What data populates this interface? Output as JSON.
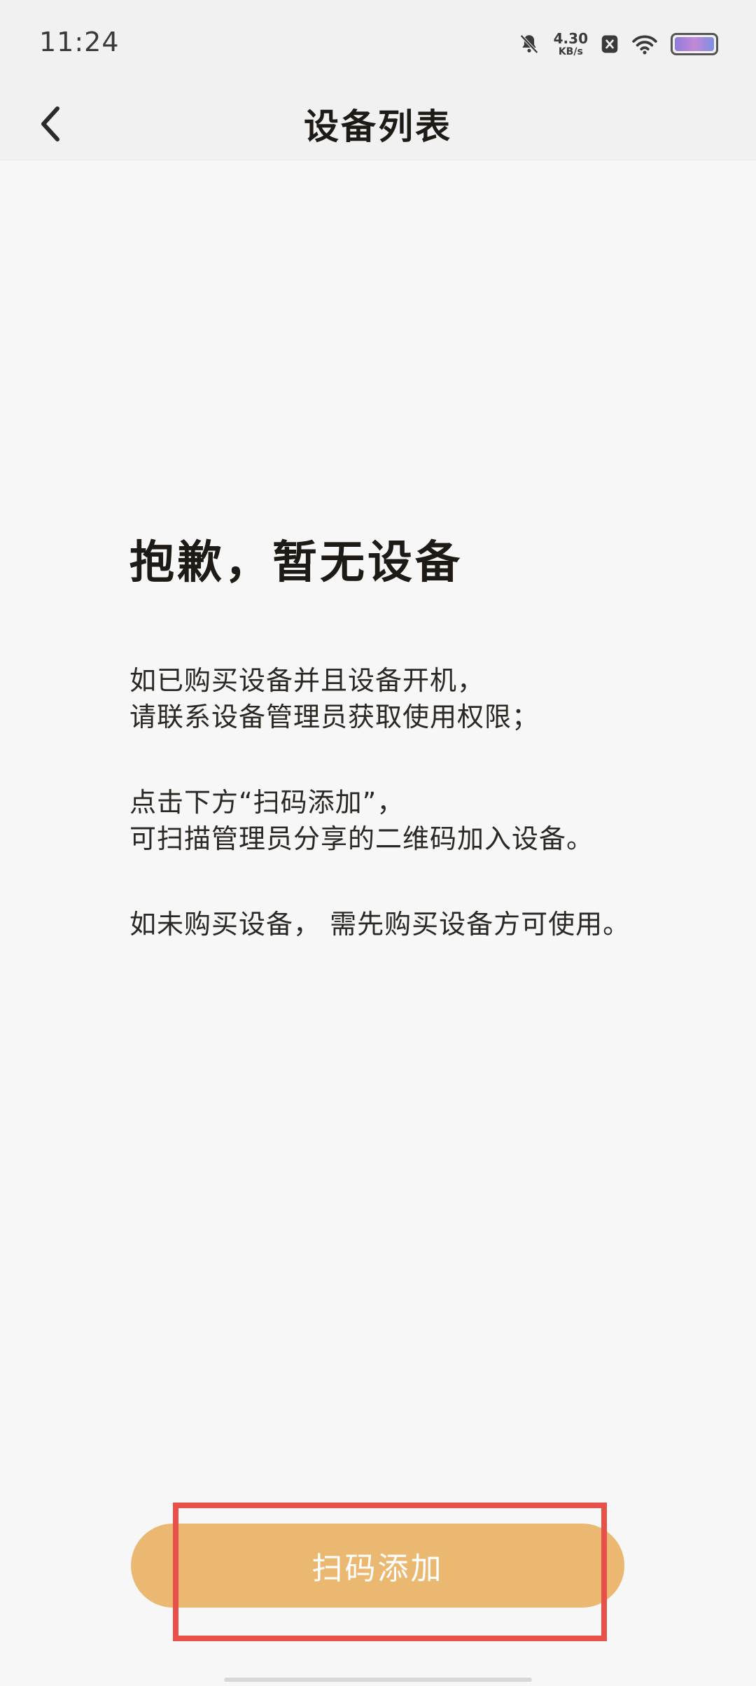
{
  "status_bar": {
    "time": "11:24",
    "net_speed_value": "4.30",
    "net_speed_unit": "KB/s",
    "icons": [
      "bell-muted-icon",
      "close-badge-icon",
      "wifi-icon",
      "battery-icon"
    ],
    "battery_gradient": [
      "#8f7bd9",
      "#c089d6",
      "#7f8fe0"
    ]
  },
  "header": {
    "title": "设备列表",
    "back_icon": "chevron-left-icon"
  },
  "empty_state": {
    "title": "抱歉，暂无设备",
    "paragraphs": [
      {
        "lines": [
          "如已购买设备并且设备开机，",
          "请联系设备管理员获取使用权限；"
        ]
      },
      {
        "lines": [
          "点击下方“扫码添加”，",
          "可扫描管理员分享的二维码加入设备。"
        ]
      },
      {
        "lines": [
          "如未购买设备， 需先购买设备方可使用。"
        ]
      }
    ]
  },
  "action": {
    "scan_add_label": "扫码添加",
    "button_color": "#ebb872",
    "highlight_color": "#e8504a"
  }
}
